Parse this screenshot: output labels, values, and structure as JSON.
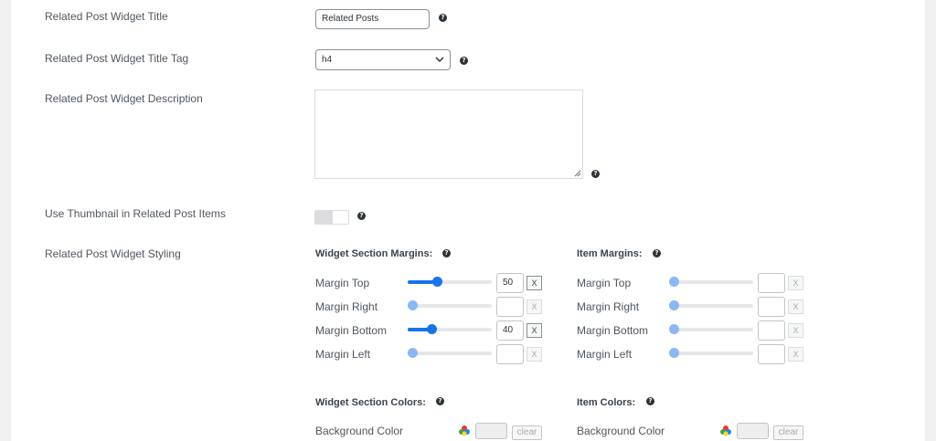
{
  "fields": {
    "widget_title": {
      "label": "Related Post Widget Title",
      "value": "Related Posts"
    },
    "title_tag": {
      "label": "Related Post Widget Title Tag",
      "value": "h4"
    },
    "description": {
      "label": "Related Post Widget Description",
      "value": ""
    },
    "thumbnail": {
      "label": "Use Thumbnail in Related Post Items",
      "enabled": false
    },
    "styling": {
      "label": "Related Post Widget Styling"
    }
  },
  "help_glyph": "?",
  "widget_margins": {
    "heading": "Widget Section Margins:",
    "rows": [
      {
        "label": "Margin Top",
        "value": "50",
        "level": 0.35,
        "active": true
      },
      {
        "label": "Margin Right",
        "value": "",
        "level": 0,
        "active": false
      },
      {
        "label": "Margin Bottom",
        "value": "40",
        "level": 0.28,
        "active": true
      },
      {
        "label": "Margin Left",
        "value": "",
        "level": 0,
        "active": false
      }
    ]
  },
  "item_margins": {
    "heading": "Item Margins:",
    "rows": [
      {
        "label": "Margin Top",
        "value": "",
        "level": 0,
        "active": false
      },
      {
        "label": "Margin Right",
        "value": "",
        "level": 0,
        "active": false
      },
      {
        "label": "Margin Bottom",
        "value": "",
        "level": 0,
        "active": false
      },
      {
        "label": "Margin Left",
        "value": "",
        "level": 0,
        "active": false
      }
    ]
  },
  "clear_x_label": "X",
  "widget_colors": {
    "heading": "Widget Section Colors:",
    "background_label": "Background Color",
    "clear_label": "clear"
  },
  "item_colors": {
    "heading": "Item Colors:",
    "background_label": "Background Color",
    "clear_label": "clear"
  },
  "colors": {
    "accent": "#1a73e8",
    "accent_light": "#8ab8f0"
  },
  "icons": {
    "help": "question-circle-icon",
    "dropdown": "chevron-down-icon",
    "color": "color-palette-icon"
  }
}
